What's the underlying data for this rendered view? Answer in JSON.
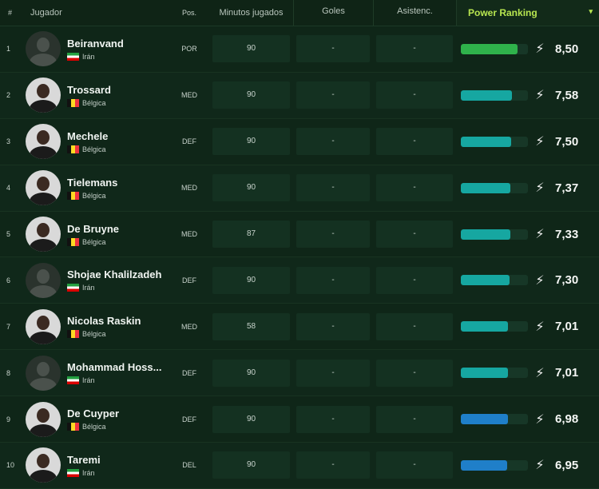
{
  "header": {
    "rank": "#",
    "player": "Jugador",
    "pos": "Pos.",
    "minutes": "Minutos jugados",
    "goals": "Goles",
    "assists": "Asistenc.",
    "power": "Power Ranking",
    "sort_icon": "▾"
  },
  "colors": {
    "bar_green": "#2fb24b",
    "bar_teal": "#16a7a1",
    "bar_blue": "#1f7fc9"
  },
  "rows": [
    {
      "rank": "1",
      "name": "Beiranvand",
      "country": "Irán",
      "flag": "iran",
      "pos": "POR",
      "minutes": "90",
      "goals": "-",
      "assists": "-",
      "score": "8,50",
      "level": 0.85,
      "bar": "green",
      "avatar": "placeholder"
    },
    {
      "rank": "2",
      "name": "Trossard",
      "country": "Bélgica",
      "flag": "belgium",
      "pos": "MED",
      "minutes": "90",
      "goals": "-",
      "assists": "-",
      "score": "7,58",
      "level": 0.758,
      "bar": "teal",
      "avatar": "photo"
    },
    {
      "rank": "3",
      "name": "Mechele",
      "country": "Bélgica",
      "flag": "belgium",
      "pos": "DEF",
      "minutes": "90",
      "goals": "-",
      "assists": "-",
      "score": "7,50",
      "level": 0.75,
      "bar": "teal",
      "avatar": "photo"
    },
    {
      "rank": "4",
      "name": "Tielemans",
      "country": "Bélgica",
      "flag": "belgium",
      "pos": "MED",
      "minutes": "90",
      "goals": "-",
      "assists": "-",
      "score": "7,37",
      "level": 0.737,
      "bar": "teal",
      "avatar": "photo"
    },
    {
      "rank": "5",
      "name": "De Bruyne",
      "country": "Bélgica",
      "flag": "belgium",
      "pos": "MED",
      "minutes": "87",
      "goals": "-",
      "assists": "-",
      "score": "7,33",
      "level": 0.733,
      "bar": "teal",
      "avatar": "photo"
    },
    {
      "rank": "6",
      "name": "Shojae Khalilzadeh",
      "country": "Irán",
      "flag": "iran",
      "pos": "DEF",
      "minutes": "90",
      "goals": "-",
      "assists": "-",
      "score": "7,30",
      "level": 0.73,
      "bar": "teal",
      "avatar": "placeholder"
    },
    {
      "rank": "7",
      "name": "Nicolas Raskin",
      "country": "Bélgica",
      "flag": "belgium",
      "pos": "MED",
      "minutes": "58",
      "goals": "-",
      "assists": "-",
      "score": "7,01",
      "level": 0.701,
      "bar": "teal",
      "avatar": "photo"
    },
    {
      "rank": "8",
      "name": "Mohammad Hoss...",
      "country": "Irán",
      "flag": "iran",
      "pos": "DEF",
      "minutes": "90",
      "goals": "-",
      "assists": "-",
      "score": "7,01",
      "level": 0.701,
      "bar": "teal",
      "avatar": "placeholder"
    },
    {
      "rank": "9",
      "name": "De Cuyper",
      "country": "Bélgica",
      "flag": "belgium",
      "pos": "DEF",
      "minutes": "90",
      "goals": "-",
      "assists": "-",
      "score": "6,98",
      "level": 0.698,
      "bar": "blue",
      "avatar": "photo"
    },
    {
      "rank": "10",
      "name": "Taremi",
      "country": "Irán",
      "flag": "iran",
      "pos": "DEL",
      "minutes": "90",
      "goals": "-",
      "assists": "-",
      "score": "6,95",
      "level": 0.695,
      "bar": "blue",
      "avatar": "photo"
    }
  ]
}
